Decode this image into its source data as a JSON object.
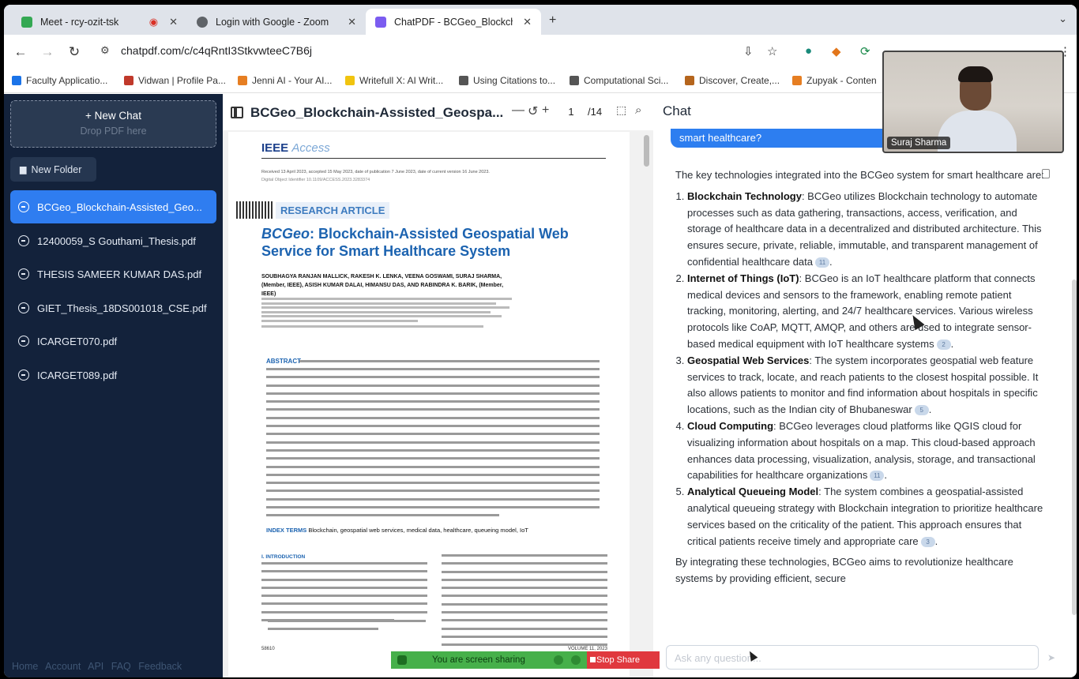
{
  "tabs": [
    {
      "label": "Meet - rcy-ozit-tsk",
      "color": "#34a853"
    },
    {
      "label": "Login with Google - Zoom",
      "color": "#5f6368"
    },
    {
      "label": "ChatPDF - BCGeo_Blockchai",
      "color": "#7b5cf0"
    }
  ],
  "url": "chatpdf.com/c/c4qRntI3StkvwteeC7B6j",
  "bookmarks": [
    {
      "label": "Faculty Applicatio...",
      "color": "#1a73e8"
    },
    {
      "label": "Vidwan | Profile Pa...",
      "color": "#c0392b"
    },
    {
      "label": "Jenni AI - Your AI...",
      "color": "#e67e22"
    },
    {
      "label": "Writefull X: AI Writ...",
      "color": "#f1c40f"
    },
    {
      "label": "Using Citations to...",
      "color": "#555555"
    },
    {
      "label": "Computational Sci...",
      "color": "#555555"
    },
    {
      "label": "Discover, Create,...",
      "color": "#b5651d"
    },
    {
      "label": "Zupyak - Conten",
      "color": "#e67e22"
    }
  ],
  "sidebar": {
    "new_chat": "+ New Chat",
    "drop_hint": "Drop PDF here",
    "new_folder": "New Folder",
    "files": [
      "BCGeo_Blockchain-Assisted_Geo...",
      "12400059_S Gouthami_Thesis.pdf",
      "THESIS SAMEER KUMAR DAS.pdf",
      "GIET_Thesis_18DS001018_CSE.pdf",
      "ICARGET070.pdf",
      "ICARGET089.pdf"
    ],
    "footer": [
      "Home",
      "Account",
      "API",
      "FAQ",
      "Feedback"
    ]
  },
  "pdf": {
    "title": "BCGeo_Blockchain-Assisted_Geospa...",
    "page": "1",
    "total": "/14",
    "journal": "IEEE",
    "journal_sub": "Access",
    "received": "Received 13 April 2023, accepted 15 May 2023, date of publication 7 June 2023, date of current version 16 June 2023.",
    "doi": "Digital Object Identifier 10.1109/ACCESS.2023.3283374",
    "article_type": "RESEARCH ARTICLE",
    "paper_title_italic": "BCGeo",
    "paper_title_rest": ": Blockchain-Assisted Geospatial Web Service for Smart Healthcare System",
    "authors": "SOUBHAGYA RANJAN MALLICK, RAKESH K. LENKA, VEENA GOSWAMI, SURAJ SHARMA, (Member, IEEE), ASISH KUMAR DALAI, HIMANSU DAS, AND RABINDRA K. BARIK, (Member, IEEE)",
    "abstract_key": "ABSTRACT",
    "index_key": "INDEX TERMS",
    "index_terms": "Blockchain, geospatial web services, medical data, healthcare, queueing model, IoT",
    "intro": "I. INTRODUCTION",
    "page_num": "58610",
    "volume": "VOLUME 11, 2023"
  },
  "chat": {
    "title": "Chat",
    "question": "smart healthcare?",
    "intro": "The key technologies integrated into the BCGeo system for smart healthcare are:",
    "items": [
      {
        "head": "Blockchain Technology",
        "text": ": BCGeo utilizes Blockchain technology to automate processes such as data gathering, transactions, access, verification, and storage of healthcare data in a decentralized and distributed architecture. This ensures secure, private, reliable, immutable, and transparent management of confidential healthcare data",
        "cite": "11"
      },
      {
        "head": "Internet of Things (IoT)",
        "text": ": BCGeo is an IoT healthcare platform that connects medical devices and sensors to the framework, enabling remote patient tracking, monitoring, alerting, and 24/7 healthcare services. Various wireless protocols like CoAP, MQTT, AMQP, and others are used to integrate sensor-based medical equipment with IoT healthcare systems",
        "cite": "2"
      },
      {
        "head": "Geospatial Web Services",
        "text": ": The system incorporates geospatial web feature services to track, locate, and reach patients to the closest hospital possible. It also allows patients to monitor and find information about hospitals in specific locations, such as the Indian city of Bhubaneswar",
        "cite": "5"
      },
      {
        "head": "Cloud Computing",
        "text": ": BCGeo leverages cloud platforms like QGIS cloud for visualizing information about hospitals on a map. This cloud-based approach enhances data processing, visualization, analysis, storage, and transactional capabilities for healthcare organizations",
        "cite": "11"
      },
      {
        "head": "Analytical Queueing Model",
        "text": ": The system combines a geospatial-assisted analytical queueing strategy with Blockchain integration to prioritize healthcare services based on the criticality of the patient. This approach ensures that critical patients receive timely and appropriate care",
        "cite": "3"
      }
    ],
    "outro": "By integrating these technologies, BCGeo aims to revolutionize healthcare systems by providing efficient, secure",
    "input_placeholder": "Ask any question..."
  },
  "video": {
    "name": "Suraj Sharma"
  },
  "share": {
    "status": "You are screen sharing",
    "stop": "Stop Share"
  }
}
